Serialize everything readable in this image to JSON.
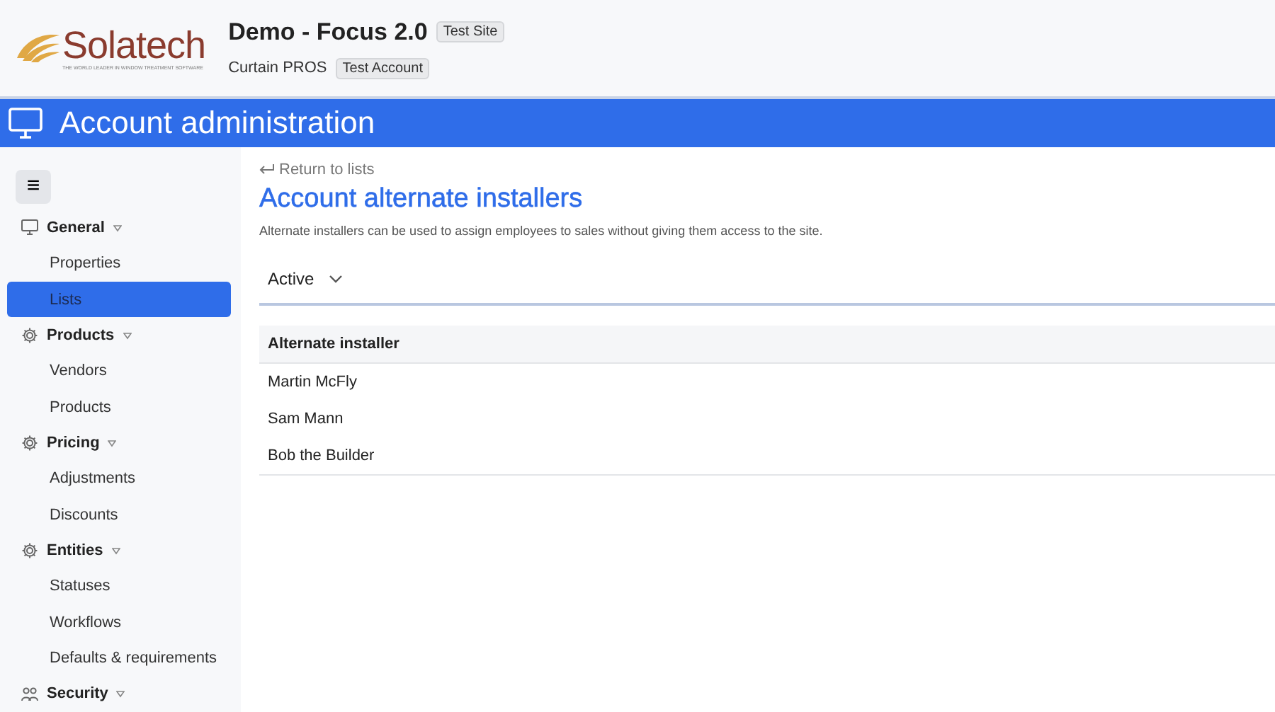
{
  "header": {
    "logo_text": "Solatech",
    "logo_tagline": "THE WORLD LEADER IN WINDOW TREATMENT SOFTWARE",
    "site_title": "Demo - Focus 2.0",
    "site_badge": "Test Site",
    "account_name": "Curtain PROS",
    "account_badge": "Test Account"
  },
  "title_bar": {
    "title": "Account administration"
  },
  "sidebar": {
    "menu_button": "≡",
    "groups": [
      {
        "label": "General",
        "expanded": true,
        "items": [
          {
            "label": "Properties",
            "selected": false
          },
          {
            "label": "Lists",
            "selected": true
          }
        ]
      },
      {
        "label": "Products",
        "expanded": true,
        "items": [
          {
            "label": "Vendors",
            "selected": false
          },
          {
            "label": "Products",
            "selected": false
          }
        ]
      },
      {
        "label": "Pricing",
        "expanded": true,
        "items": [
          {
            "label": "Adjustments",
            "selected": false
          },
          {
            "label": "Discounts",
            "selected": false
          }
        ]
      },
      {
        "label": "Entities",
        "expanded": true,
        "items": [
          {
            "label": "Statuses",
            "selected": false
          },
          {
            "label": "Workflows",
            "selected": false
          },
          {
            "label": "Defaults & requirements",
            "selected": false
          }
        ]
      },
      {
        "label": "Security",
        "expanded": true
      }
    ]
  },
  "content": {
    "back_link": "Return to lists",
    "heading": "Account alternate installers",
    "description": "Alternate installers can be used to assign employees to sales without giving them access to the site.",
    "filter": "Active",
    "table": {
      "columns": [
        "Alternate installer"
      ],
      "rows": [
        [
          "Martin McFly"
        ],
        [
          "Sam Mann"
        ],
        [
          "Bob the Builder"
        ]
      ]
    }
  }
}
